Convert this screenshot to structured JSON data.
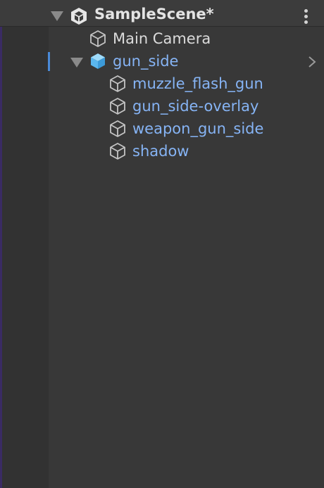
{
  "scene": {
    "name": "SampleScene*",
    "icon": "unity-logo-icon",
    "menu_icon": "kebab-menu-icon"
  },
  "hierarchy": {
    "items": [
      {
        "label": "Main Camera",
        "icon": "gameobject-icon",
        "color": "#dcdcdc"
      },
      {
        "label": "gun_side",
        "icon": "prefab-icon",
        "color": "#86b4f5",
        "expanded": true,
        "selected": true
      },
      {
        "label": "muzzle_flash_gun",
        "icon": "gameobject-icon",
        "color": "#86b4f5"
      },
      {
        "label": "gun_side-overlay",
        "icon": "gameobject-icon",
        "color": "#86b4f5"
      },
      {
        "label": "weapon_gun_side",
        "icon": "gameobject-icon",
        "color": "#86b4f5"
      },
      {
        "label": "shadow",
        "icon": "gameobject-icon",
        "color": "#86b4f5"
      }
    ]
  },
  "colors": {
    "background": "#383838",
    "gutter": "#323232",
    "prefab_text": "#86b4f5",
    "selection_accent": "#4a8ad8",
    "prefab_icon": "#5bb7ee"
  }
}
